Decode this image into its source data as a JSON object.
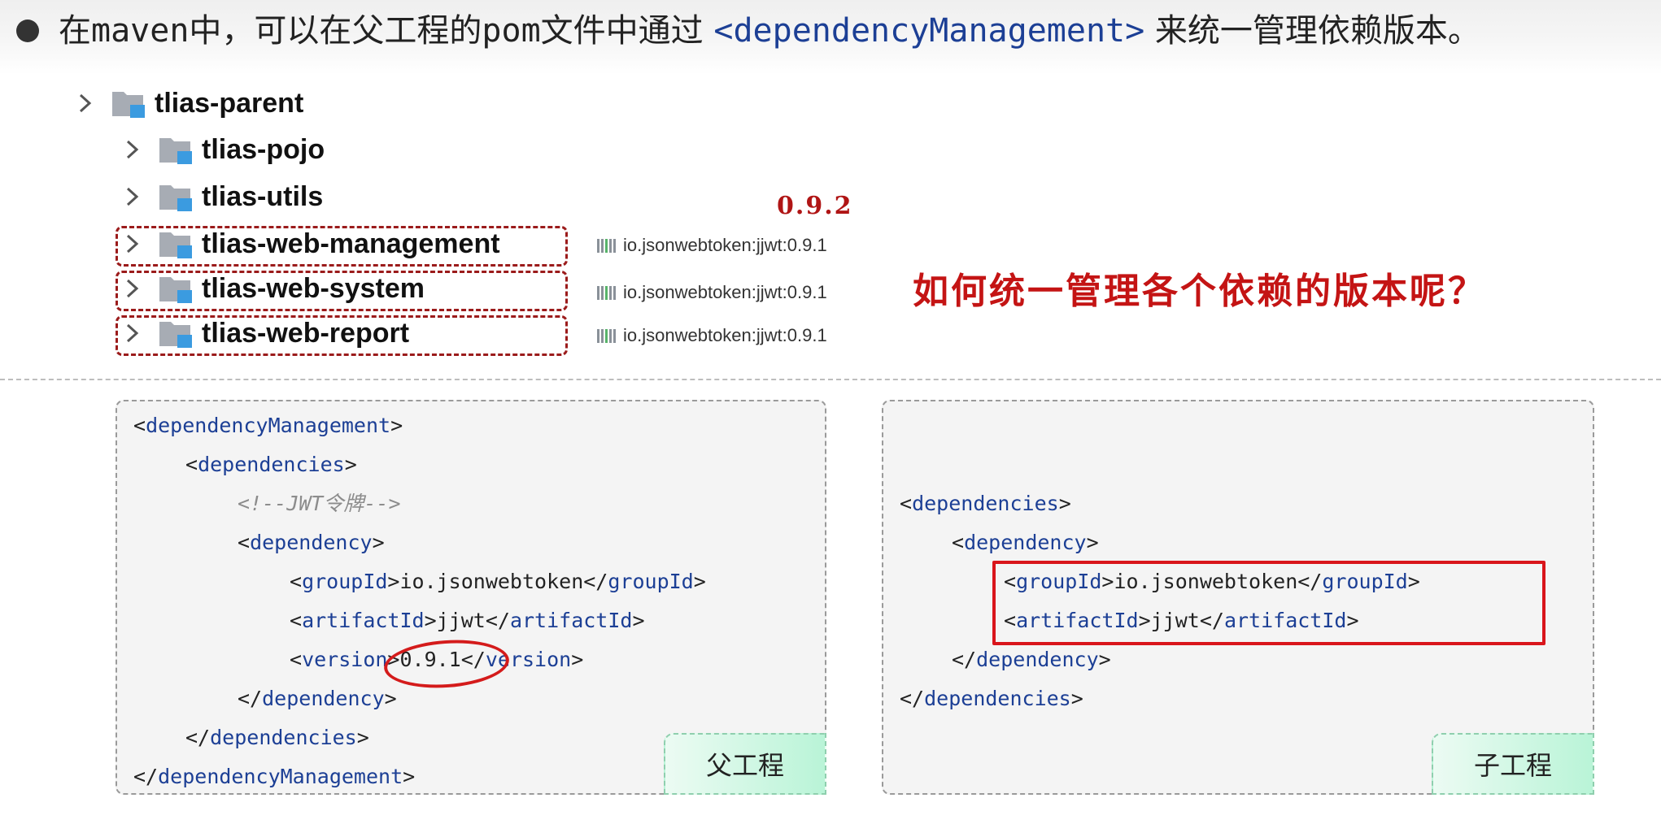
{
  "header": {
    "part1": "在",
    "maven": "maven",
    "part2": "中，可以在父工程的",
    "pom": "pom",
    "part3": "文件中通过 ",
    "tag": "<dependencyManagement>",
    "part4": " 来统一管理依赖版本。"
  },
  "tree": {
    "items": [
      {
        "label": "tlias-parent"
      },
      {
        "label": "tlias-pojo"
      },
      {
        "label": "tlias-utils"
      },
      {
        "label": "tlias-web-management"
      },
      {
        "label": "tlias-web-system"
      },
      {
        "label": "tlias-web-report"
      }
    ]
  },
  "dependencies": [
    {
      "label": "io.jsonwebtoken:jjwt:0.9.1"
    },
    {
      "label": "io.jsonwebtoken:jjwt:0.9.1"
    },
    {
      "label": "io.jsonwebtoken:jjwt:0.9.1"
    }
  ],
  "annotations": {
    "version_note": "0.9.2",
    "question": "如何统一管理各个依赖的版本呢？"
  },
  "parent_panel": {
    "label": "父工程",
    "lines": {
      "l1_open": "<",
      "l1_tag": "dependencyManagement",
      "l1_close": ">",
      "l2_open": "<",
      "l2_tag": "dependencies",
      "l2_close": ">",
      "l3_comment": "<!--JWT令牌-->",
      "l4_open": "<",
      "l4_tag": "dependency",
      "l4_close": ">",
      "l5_a": "<",
      "l5_tag": "groupId",
      "l5_b": ">io.jsonwebtoken</",
      "l5_tag2": "groupId",
      "l5_c": ">",
      "l6_a": "<",
      "l6_tag": "artifactId",
      "l6_b": ">jjwt</",
      "l6_tag2": "artifactId",
      "l6_c": ">",
      "l7_a": "<",
      "l7_tag": "version",
      "l7_b": ">0.9.1</",
      "l7_tag2": "version",
      "l7_c": ">",
      "l8_open": "</",
      "l8_tag": "dependency",
      "l8_close": ">",
      "l9_open": "</",
      "l9_tag": "dependencies",
      "l9_close": ">",
      "l10_open": "</",
      "l10_tag": "dependencyManagement",
      "l10_close": ">"
    }
  },
  "child_panel": {
    "label": "子工程",
    "lines": {
      "l1_open": "<",
      "l1_tag": "dependencies",
      "l1_close": ">",
      "l2_open": "<",
      "l2_tag": "dependency",
      "l2_close": ">",
      "l3_a": "<",
      "l3_tag": "groupId",
      "l3_b": ">io.jsonwebtoken</",
      "l3_tag2": "groupId",
      "l3_c": ">",
      "l4_a": "<",
      "l4_tag": "artifactId",
      "l4_b": ">jjwt</",
      "l4_tag2": "artifactId",
      "l4_c": ">",
      "l5_open": "</",
      "l5_tag": "dependency",
      "l5_close": ">",
      "l6_open": "</",
      "l6_tag": "dependencies",
      "l6_close": ">"
    }
  },
  "colors": {
    "tag": "#1c3f95",
    "annotation_red": "#c41414",
    "folder_gray": "#a7acb4",
    "folder_blue": "#3b9be0"
  }
}
